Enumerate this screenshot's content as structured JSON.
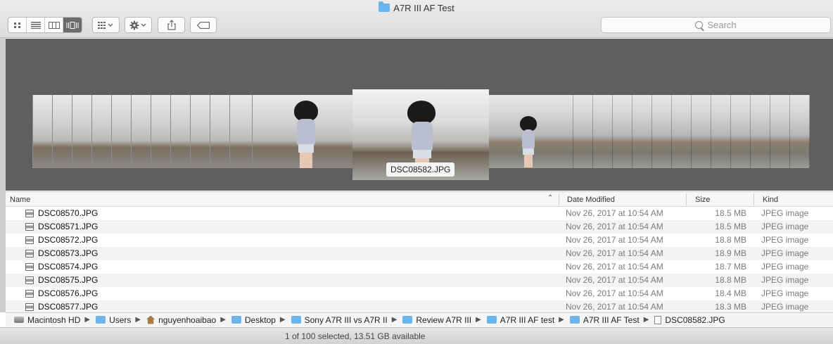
{
  "window": {
    "title": "A7R III AF Test"
  },
  "toolbar": {
    "view_buttons": [
      "icon-view",
      "list-view",
      "column-view",
      "cover-flow-view"
    ],
    "search_placeholder": "Search"
  },
  "coverflow": {
    "selected_caption": "DSC08582.JPG"
  },
  "columns": {
    "name": "Name",
    "date": "Date Modified",
    "size": "Size",
    "kind": "Kind"
  },
  "files": [
    {
      "name": "DSC08570.JPG",
      "date": "Nov 26, 2017 at 10:54 AM",
      "size": "18.5 MB",
      "kind": "JPEG image"
    },
    {
      "name": "DSC08571.JPG",
      "date": "Nov 26, 2017 at 10:54 AM",
      "size": "18.5 MB",
      "kind": "JPEG image"
    },
    {
      "name": "DSC08572.JPG",
      "date": "Nov 26, 2017 at 10:54 AM",
      "size": "18.8 MB",
      "kind": "JPEG image"
    },
    {
      "name": "DSC08573.JPG",
      "date": "Nov 26, 2017 at 10:54 AM",
      "size": "18.9 MB",
      "kind": "JPEG image"
    },
    {
      "name": "DSC08574.JPG",
      "date": "Nov 26, 2017 at 10:54 AM",
      "size": "18.7 MB",
      "kind": "JPEG image"
    },
    {
      "name": "DSC08575.JPG",
      "date": "Nov 26, 2017 at 10:54 AM",
      "size": "18.8 MB",
      "kind": "JPEG image"
    },
    {
      "name": "DSC08576.JPG",
      "date": "Nov 26, 2017 at 10:54 AM",
      "size": "18.4 MB",
      "kind": "JPEG image"
    },
    {
      "name": "DSC08577.JPG",
      "date": "Nov 26, 2017 at 10:54 AM",
      "size": "18.3 MB",
      "kind": "JPEG image"
    }
  ],
  "path": [
    {
      "label": "Macintosh HD",
      "icon": "hd"
    },
    {
      "label": "Users",
      "icon": "folder"
    },
    {
      "label": "nguyenhoaibao",
      "icon": "home"
    },
    {
      "label": "Desktop",
      "icon": "folder"
    },
    {
      "label": "Sony A7R III vs A7R II",
      "icon": "folder"
    },
    {
      "label": "Review A7R III",
      "icon": "folder"
    },
    {
      "label": "A7R III AF test",
      "icon": "folder"
    },
    {
      "label": "A7R III AF Test",
      "icon": "folder"
    },
    {
      "label": "DSC08582.JPG",
      "icon": "doc"
    }
  ],
  "status": {
    "text": "1 of 100 selected, 13.51 GB available"
  }
}
